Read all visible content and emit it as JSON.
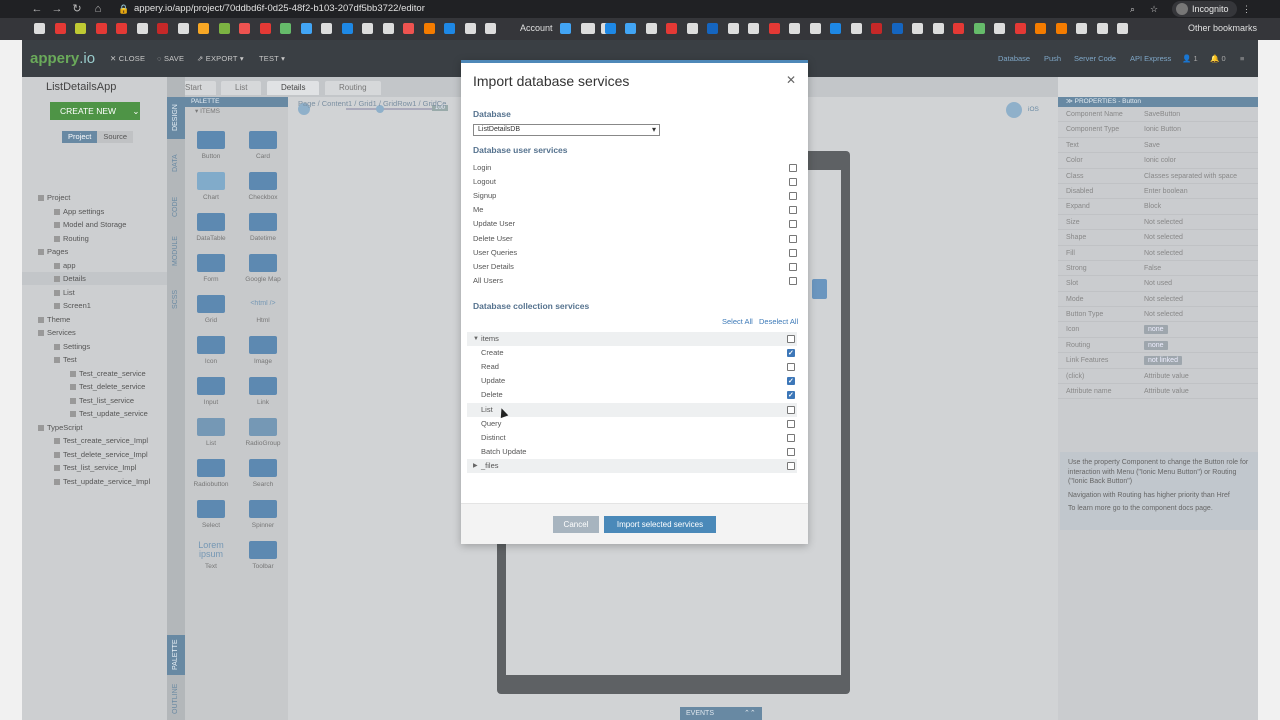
{
  "browser": {
    "url": "appery.io/app/project/70ddbd6f-0d25-48f2-b103-207df5bb3722/editor",
    "profile": "Incognito",
    "bookmark_account": "Account",
    "other_bookmarks": "Other bookmarks"
  },
  "topbar": {
    "logo_a": "appery",
    "logo_b": ".io",
    "close": "CLOSE",
    "save": "SAVE",
    "export": "EXPORT",
    "test": "TEST",
    "links": [
      "Database",
      "Push",
      "Server Code",
      "API Express"
    ],
    "user_count": "1",
    "notif_count": "0"
  },
  "project": {
    "name": "ListDetailsApp",
    "create_new": "CREATE NEW",
    "tab_project": "Project",
    "tab_source": "Source",
    "tree": [
      {
        "label": "Project",
        "level": 0
      },
      {
        "label": "App settings",
        "level": 1
      },
      {
        "label": "Model and Storage",
        "level": 1
      },
      {
        "label": "Routing",
        "level": 1
      },
      {
        "label": "Pages",
        "level": 0
      },
      {
        "label": "app",
        "level": 1
      },
      {
        "label": "Details",
        "level": 1
      },
      {
        "label": "List",
        "level": 1
      },
      {
        "label": "Screen1",
        "level": 1
      },
      {
        "label": "Theme",
        "level": 0
      },
      {
        "label": "Services",
        "level": 0
      },
      {
        "label": "Settings",
        "level": 1
      },
      {
        "label": "Test",
        "level": 1
      },
      {
        "label": "Test_create_service",
        "level": 2
      },
      {
        "label": "Test_delete_service",
        "level": 2
      },
      {
        "label": "Test_list_service",
        "level": 2
      },
      {
        "label": "Test_update_service",
        "level": 2
      },
      {
        "label": "TypeScript",
        "level": 0
      },
      {
        "label": "Test_create_service_Impl",
        "level": 1
      },
      {
        "label": "Test_delete_service_Impl",
        "level": 1
      },
      {
        "label": "Test_list_service_Impl",
        "level": 1
      },
      {
        "label": "Test_update_service_Impl",
        "level": 1
      }
    ]
  },
  "vtabs": [
    "DESIGN",
    "DATA",
    "CODE",
    "MODULE",
    "SCSS",
    "PALETTE",
    "OUTLINE"
  ],
  "editor_tabs": [
    "Start",
    "List",
    "Details",
    "Routing"
  ],
  "breadcrumb": "Page  /  Content1  /  Grid1  /  GridRow1  /  GridCe",
  "zoom": "100",
  "palette": {
    "title": "PALETTE",
    "section": "ITEMS",
    "items": [
      "Button",
      "Card",
      "Chart",
      "Checkbox",
      "DataTable",
      "Datetime",
      "Form",
      "Google Map",
      "Grid",
      "Html",
      "Icon",
      "Image",
      "Input",
      "Link",
      "List",
      "RadioGroup",
      "Radiobutton",
      "Search",
      "Select",
      "Spinner",
      "Text",
      "Toolbar"
    ],
    "html_icon": "<html />",
    "lorem": "Lorem ipsum"
  },
  "events_label": "EVENTS",
  "properties": {
    "title": "PROPERTIES - Button",
    "rows": [
      [
        "Component Name",
        "SaveButton"
      ],
      [
        "Component Type",
        "Ionic Button"
      ],
      [
        "Text",
        "Save"
      ],
      [
        "Color",
        "Ionic color"
      ],
      [
        "Class",
        "Classes separated with space"
      ],
      [
        "Disabled",
        "Enter boolean"
      ],
      [
        "Expand",
        "Block"
      ],
      [
        "Size",
        "Not selected"
      ],
      [
        "Shape",
        "Not selected"
      ],
      [
        "Fill",
        "Not selected"
      ],
      [
        "Strong",
        "False"
      ],
      [
        "Slot",
        "Not used"
      ],
      [
        "Mode",
        "Not selected"
      ],
      [
        "Button Type",
        "Not selected"
      ],
      [
        "Icon",
        "none"
      ],
      [
        "Routing",
        "none"
      ],
      [
        "Link Features",
        "not linked"
      ],
      [
        "(click)",
        "Attribute value"
      ],
      [
        "Attribute name",
        "Attribute value"
      ]
    ],
    "help1": "Use the property Component to change the Button role for interaction with Menu (\"Ionic Menu Button\") or Routing (\"Ionic Back Button\")",
    "help2": "Navigation with Routing has higher priority than Href",
    "help3": "To learn more go to the component docs page."
  },
  "modal": {
    "title": "Import database services",
    "database_label": "Database",
    "database_value": "ListDetailsDB",
    "user_services_title": "Database user services",
    "user_services": [
      {
        "label": "Login",
        "checked": false
      },
      {
        "label": "Logout",
        "checked": false
      },
      {
        "label": "Signup",
        "checked": false
      },
      {
        "label": "Me",
        "checked": false
      },
      {
        "label": "Update User",
        "checked": false
      },
      {
        "label": "Delete User",
        "checked": false
      },
      {
        "label": "User Queries",
        "checked": false
      },
      {
        "label": "User Details",
        "checked": false
      },
      {
        "label": "All Users",
        "checked": false
      }
    ],
    "collection_title": "Database collection services",
    "select_all": "Select All",
    "deselect_all": "Deselect All",
    "collections": [
      {
        "label": "items",
        "type": "group",
        "expanded": true,
        "checked": false
      },
      {
        "label": "Create",
        "type": "item",
        "checked": true
      },
      {
        "label": "Read",
        "type": "item",
        "checked": false
      },
      {
        "label": "Update",
        "type": "item",
        "checked": true
      },
      {
        "label": "Delete",
        "type": "item",
        "checked": true
      },
      {
        "label": "List",
        "type": "item",
        "checked": false
      },
      {
        "label": "Query",
        "type": "item",
        "checked": false
      },
      {
        "label": "Distinct",
        "type": "item",
        "checked": false
      },
      {
        "label": "Batch Update",
        "type": "item",
        "checked": false
      },
      {
        "label": "_files",
        "type": "group",
        "expanded": false,
        "checked": false
      }
    ],
    "cancel": "Cancel",
    "import": "Import selected services"
  },
  "colors": {
    "accent": "#4a89b9",
    "checked": "#3d77b8",
    "section": "#55728e",
    "create_btn": "#4e9446"
  }
}
